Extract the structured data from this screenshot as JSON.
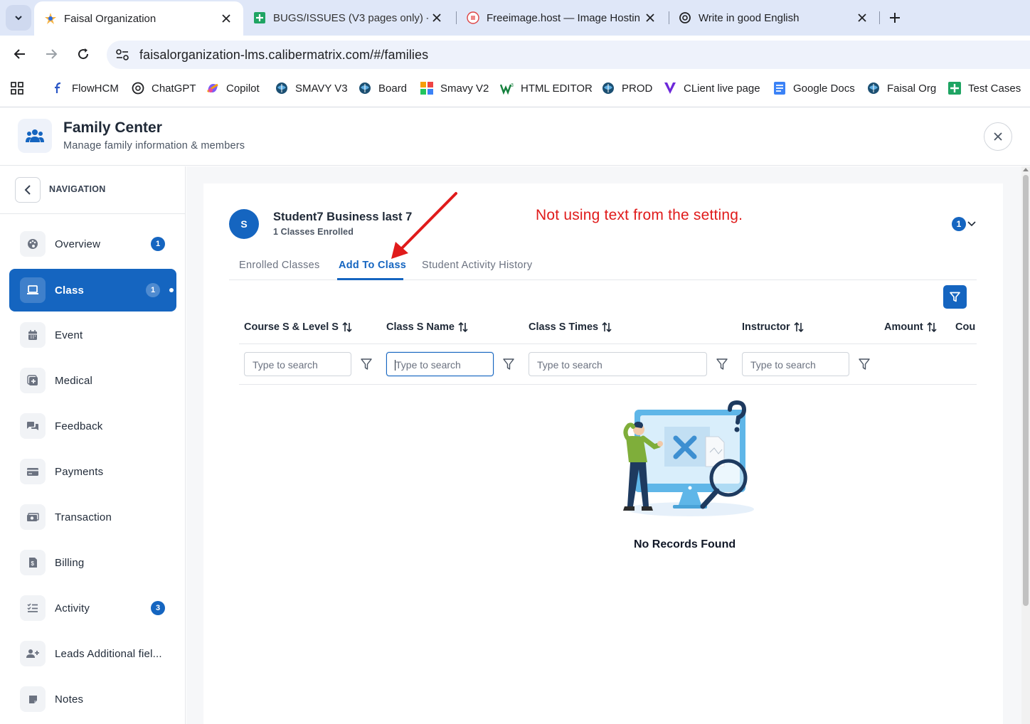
{
  "browser": {
    "tabs": [
      {
        "title": "Faisal Organization",
        "active": true,
        "icon": "org-logo-icon"
      },
      {
        "title": "BUGS/ISSUES (V3 pages only) -",
        "active": false,
        "icon": "sheets-icon"
      },
      {
        "title": "Freeimage.host — Image Hostin",
        "active": false,
        "icon": "freeimage-icon"
      },
      {
        "title": "Write in good English",
        "active": false,
        "icon": "chatgpt-icon"
      }
    ],
    "url": "faisalorganization-lms.calibermatrix.com/#/families",
    "bookmarks": [
      {
        "label": "FlowHCM",
        "icon": "flowhcm-icon"
      },
      {
        "label": "ChatGPT",
        "icon": "chatgpt-icon"
      },
      {
        "label": "Copilot",
        "icon": "copilot-icon"
      },
      {
        "label": "SMAVY V3",
        "icon": "smavy-globe-icon"
      },
      {
        "label": "Board",
        "icon": "smavy-globe-icon"
      },
      {
        "label": "Smavy V2",
        "icon": "smavy-v2-icon"
      },
      {
        "label": "HTML EDITOR",
        "icon": "html-editor-icon"
      },
      {
        "label": "PROD",
        "icon": "smavy-globe-icon"
      },
      {
        "label": "CLient live page",
        "icon": "vuetify-icon"
      },
      {
        "label": "Google Docs",
        "icon": "docs-icon"
      },
      {
        "label": "Faisal Org",
        "icon": "smavy-globe-icon"
      },
      {
        "label": "Test Cases",
        "icon": "sheets-icon"
      }
    ]
  },
  "header": {
    "title": "Family Center",
    "subtitle": "Manage family information & members"
  },
  "sidebar": {
    "title": "NAVIGATION",
    "items": [
      {
        "label": "Overview",
        "icon": "palette-icon",
        "badge": "1"
      },
      {
        "label": "Class",
        "icon": "laptop-icon",
        "badge": "1",
        "active": true
      },
      {
        "label": "Event",
        "icon": "calendar-icon"
      },
      {
        "label": "Medical",
        "icon": "medical-icon"
      },
      {
        "label": "Feedback",
        "icon": "chat-icon"
      },
      {
        "label": "Payments",
        "icon": "card-icon"
      },
      {
        "label": "Transaction",
        "icon": "cash-icon"
      },
      {
        "label": "Billing",
        "icon": "invoice-icon"
      },
      {
        "label": "Activity",
        "icon": "checklist-icon",
        "badge": "3"
      },
      {
        "label": "Leads Additional fiel...",
        "icon": "user-plus-icon"
      },
      {
        "label": "Notes",
        "icon": "note-icon"
      }
    ]
  },
  "student": {
    "initial": "S",
    "name": "Student7 Business last 7",
    "enrolled": "1 Classes Enrolled",
    "count": "1"
  },
  "annotation": {
    "note": "Not using text from the setting."
  },
  "tabs": [
    {
      "label": "Enrolled Classes"
    },
    {
      "label": "Add To Class",
      "active": true
    },
    {
      "label": "Student Activity History"
    }
  ],
  "table": {
    "columns": [
      "Course S & Level S",
      "Class S Name",
      "Class S Times",
      "Instructor",
      "Amount",
      "Cou"
    ],
    "search_placeholder": "Type to search",
    "empty_text": "No Records Found"
  },
  "colors": {
    "primary": "#1565c0",
    "annotation": "#e01b1b"
  }
}
